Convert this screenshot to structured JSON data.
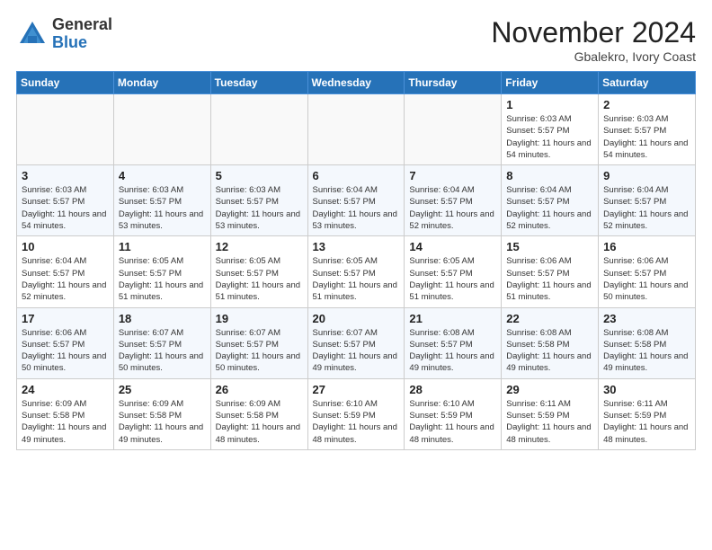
{
  "header": {
    "logo_line1": "General",
    "logo_line2": "Blue",
    "month_title": "November 2024",
    "location": "Gbalekro, Ivory Coast"
  },
  "days_of_week": [
    "Sunday",
    "Monday",
    "Tuesday",
    "Wednesday",
    "Thursday",
    "Friday",
    "Saturday"
  ],
  "weeks": [
    {
      "alt": false,
      "days": [
        {
          "num": "",
          "empty": true
        },
        {
          "num": "",
          "empty": true
        },
        {
          "num": "",
          "empty": true
        },
        {
          "num": "",
          "empty": true
        },
        {
          "num": "",
          "empty": true
        },
        {
          "num": "1",
          "sunrise": "Sunrise: 6:03 AM",
          "sunset": "Sunset: 5:57 PM",
          "daylight": "Daylight: 11 hours and 54 minutes."
        },
        {
          "num": "2",
          "sunrise": "Sunrise: 6:03 AM",
          "sunset": "Sunset: 5:57 PM",
          "daylight": "Daylight: 11 hours and 54 minutes."
        }
      ]
    },
    {
      "alt": true,
      "days": [
        {
          "num": "3",
          "sunrise": "Sunrise: 6:03 AM",
          "sunset": "Sunset: 5:57 PM",
          "daylight": "Daylight: 11 hours and 54 minutes."
        },
        {
          "num": "4",
          "sunrise": "Sunrise: 6:03 AM",
          "sunset": "Sunset: 5:57 PM",
          "daylight": "Daylight: 11 hours and 53 minutes."
        },
        {
          "num": "5",
          "sunrise": "Sunrise: 6:03 AM",
          "sunset": "Sunset: 5:57 PM",
          "daylight": "Daylight: 11 hours and 53 minutes."
        },
        {
          "num": "6",
          "sunrise": "Sunrise: 6:04 AM",
          "sunset": "Sunset: 5:57 PM",
          "daylight": "Daylight: 11 hours and 53 minutes."
        },
        {
          "num": "7",
          "sunrise": "Sunrise: 6:04 AM",
          "sunset": "Sunset: 5:57 PM",
          "daylight": "Daylight: 11 hours and 52 minutes."
        },
        {
          "num": "8",
          "sunrise": "Sunrise: 6:04 AM",
          "sunset": "Sunset: 5:57 PM",
          "daylight": "Daylight: 11 hours and 52 minutes."
        },
        {
          "num": "9",
          "sunrise": "Sunrise: 6:04 AM",
          "sunset": "Sunset: 5:57 PM",
          "daylight": "Daylight: 11 hours and 52 minutes."
        }
      ]
    },
    {
      "alt": false,
      "days": [
        {
          "num": "10",
          "sunrise": "Sunrise: 6:04 AM",
          "sunset": "Sunset: 5:57 PM",
          "daylight": "Daylight: 11 hours and 52 minutes."
        },
        {
          "num": "11",
          "sunrise": "Sunrise: 6:05 AM",
          "sunset": "Sunset: 5:57 PM",
          "daylight": "Daylight: 11 hours and 51 minutes."
        },
        {
          "num": "12",
          "sunrise": "Sunrise: 6:05 AM",
          "sunset": "Sunset: 5:57 PM",
          "daylight": "Daylight: 11 hours and 51 minutes."
        },
        {
          "num": "13",
          "sunrise": "Sunrise: 6:05 AM",
          "sunset": "Sunset: 5:57 PM",
          "daylight": "Daylight: 11 hours and 51 minutes."
        },
        {
          "num": "14",
          "sunrise": "Sunrise: 6:05 AM",
          "sunset": "Sunset: 5:57 PM",
          "daylight": "Daylight: 11 hours and 51 minutes."
        },
        {
          "num": "15",
          "sunrise": "Sunrise: 6:06 AM",
          "sunset": "Sunset: 5:57 PM",
          "daylight": "Daylight: 11 hours and 51 minutes."
        },
        {
          "num": "16",
          "sunrise": "Sunrise: 6:06 AM",
          "sunset": "Sunset: 5:57 PM",
          "daylight": "Daylight: 11 hours and 50 minutes."
        }
      ]
    },
    {
      "alt": true,
      "days": [
        {
          "num": "17",
          "sunrise": "Sunrise: 6:06 AM",
          "sunset": "Sunset: 5:57 PM",
          "daylight": "Daylight: 11 hours and 50 minutes."
        },
        {
          "num": "18",
          "sunrise": "Sunrise: 6:07 AM",
          "sunset": "Sunset: 5:57 PM",
          "daylight": "Daylight: 11 hours and 50 minutes."
        },
        {
          "num": "19",
          "sunrise": "Sunrise: 6:07 AM",
          "sunset": "Sunset: 5:57 PM",
          "daylight": "Daylight: 11 hours and 50 minutes."
        },
        {
          "num": "20",
          "sunrise": "Sunrise: 6:07 AM",
          "sunset": "Sunset: 5:57 PM",
          "daylight": "Daylight: 11 hours and 49 minutes."
        },
        {
          "num": "21",
          "sunrise": "Sunrise: 6:08 AM",
          "sunset": "Sunset: 5:57 PM",
          "daylight": "Daylight: 11 hours and 49 minutes."
        },
        {
          "num": "22",
          "sunrise": "Sunrise: 6:08 AM",
          "sunset": "Sunset: 5:58 PM",
          "daylight": "Daylight: 11 hours and 49 minutes."
        },
        {
          "num": "23",
          "sunrise": "Sunrise: 6:08 AM",
          "sunset": "Sunset: 5:58 PM",
          "daylight": "Daylight: 11 hours and 49 minutes."
        }
      ]
    },
    {
      "alt": false,
      "days": [
        {
          "num": "24",
          "sunrise": "Sunrise: 6:09 AM",
          "sunset": "Sunset: 5:58 PM",
          "daylight": "Daylight: 11 hours and 49 minutes."
        },
        {
          "num": "25",
          "sunrise": "Sunrise: 6:09 AM",
          "sunset": "Sunset: 5:58 PM",
          "daylight": "Daylight: 11 hours and 49 minutes."
        },
        {
          "num": "26",
          "sunrise": "Sunrise: 6:09 AM",
          "sunset": "Sunset: 5:58 PM",
          "daylight": "Daylight: 11 hours and 48 minutes."
        },
        {
          "num": "27",
          "sunrise": "Sunrise: 6:10 AM",
          "sunset": "Sunset: 5:59 PM",
          "daylight": "Daylight: 11 hours and 48 minutes."
        },
        {
          "num": "28",
          "sunrise": "Sunrise: 6:10 AM",
          "sunset": "Sunset: 5:59 PM",
          "daylight": "Daylight: 11 hours and 48 minutes."
        },
        {
          "num": "29",
          "sunrise": "Sunrise: 6:11 AM",
          "sunset": "Sunset: 5:59 PM",
          "daylight": "Daylight: 11 hours and 48 minutes."
        },
        {
          "num": "30",
          "sunrise": "Sunrise: 6:11 AM",
          "sunset": "Sunset: 5:59 PM",
          "daylight": "Daylight: 11 hours and 48 minutes."
        }
      ]
    }
  ]
}
